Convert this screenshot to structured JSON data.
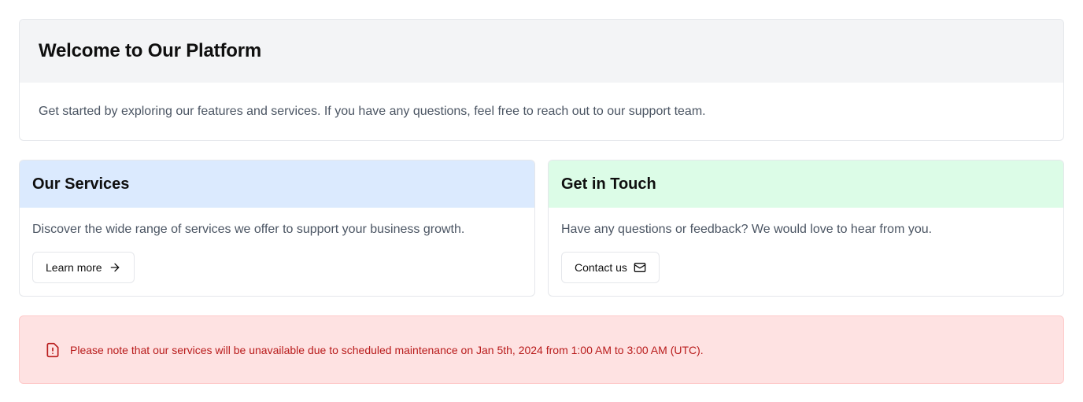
{
  "welcome": {
    "title": "Welcome to Our Platform",
    "description": "Get started by exploring our features and services. If you have any questions, feel free to reach out to our support team."
  },
  "services": {
    "title": "Our Services",
    "description": "Discover the wide range of services we offer to support your business growth.",
    "button_label": "Learn more",
    "button_icon": "arrow-right-icon"
  },
  "contact": {
    "title": "Get in Touch",
    "description": "Have any questions or feedback? We would love to hear from you.",
    "button_label": "Contact us",
    "button_icon": "mail-icon"
  },
  "alert": {
    "icon": "alert-octagon-icon",
    "message": "Please note that our services will be unavailable due to scheduled maintenance on Jan 5th, 2024 from 1:00 AM to 3:00 AM (UTC)."
  },
  "colors": {
    "welcome_header_bg": "#f3f4f6",
    "services_header_bg": "#dbeafe",
    "contact_header_bg": "#dcfce7",
    "alert_bg": "#fee2e2",
    "alert_text": "#b91c1c"
  }
}
